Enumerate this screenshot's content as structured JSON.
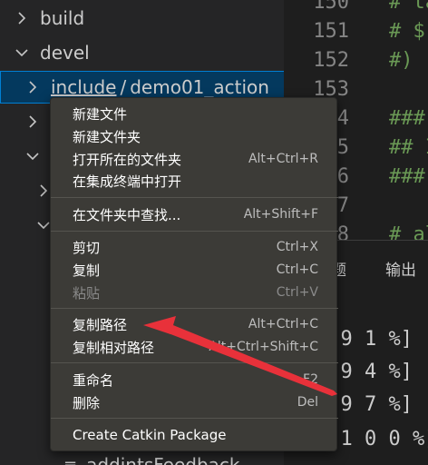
{
  "explorer": {
    "rows": [
      {
        "chevron": "chevron-right-icon",
        "label": "build"
      },
      {
        "chevron": "chevron-down-icon",
        "label": "devel"
      },
      {
        "chevron": "chevron-right-icon",
        "label_include": "include",
        "separator": "/",
        "label_pkg": "demo01_action"
      },
      {
        "chevron": "chevron-right-icon"
      },
      {
        "chevron": "chevron-down-icon"
      },
      {
        "chevron": "chevron-right-icon"
      },
      {
        "chevron": "chevron-down-icon"
      }
    ],
    "bottom_partial_label": "addintsFeedback"
  },
  "editor": {
    "lines": [
      {
        "number": "150",
        "code": "# ta"
      },
      {
        "number": "151",
        "code": "#  $"
      },
      {
        "number": "152",
        "code": "#)"
      },
      {
        "number": "153",
        "code": ""
      },
      {
        "number": "154",
        "code": "###"
      },
      {
        "number": "155",
        "code": "## I"
      },
      {
        "number": "156",
        "code": "###"
      },
      {
        "number": "157",
        "code": ""
      },
      {
        "number": "158",
        "code": "# al"
      }
    ]
  },
  "panel": {
    "tabs": [
      "题",
      "输出"
    ],
    "terminal_lines": [
      "[ 9 1 %]",
      "[ 9 4 %]",
      "[ 9 7 %]",
      "[ 1 0 0 %]"
    ]
  },
  "context_menu": {
    "groups": [
      [
        {
          "label": "新建文件",
          "shortcut": ""
        },
        {
          "label": "新建文件夹",
          "shortcut": ""
        },
        {
          "label": "打开所在的文件夹",
          "shortcut": "Alt+Ctrl+R"
        },
        {
          "label": "在集成终端中打开",
          "shortcut": ""
        }
      ],
      [
        {
          "label": "在文件夹中查找...",
          "shortcut": "Alt+Shift+F"
        }
      ],
      [
        {
          "label": "剪切",
          "shortcut": "Ctrl+X"
        },
        {
          "label": "复制",
          "shortcut": "Ctrl+C"
        },
        {
          "label": "粘贴",
          "shortcut": "Ctrl+V",
          "disabled": true
        }
      ],
      [
        {
          "label": "复制路径",
          "shortcut": "Alt+Ctrl+C"
        },
        {
          "label": "复制相对路径",
          "shortcut": "Alt+Ctrl+Shift+C"
        }
      ],
      [
        {
          "label": "重命名",
          "shortcut": "F2"
        },
        {
          "label": "删除",
          "shortcut": "Del"
        }
      ],
      [
        {
          "label": "Create Catkin Package",
          "shortcut": ""
        }
      ]
    ]
  },
  "colors": {
    "sidebar_bg": "#252526",
    "editor_bg": "#1e1e1e",
    "selection_bg": "#04395e",
    "selection_border": "#007fd4",
    "menu_bg": "#3c3b37",
    "comment_green": "#6a9955",
    "annotation_arrow": "#e8313a"
  }
}
